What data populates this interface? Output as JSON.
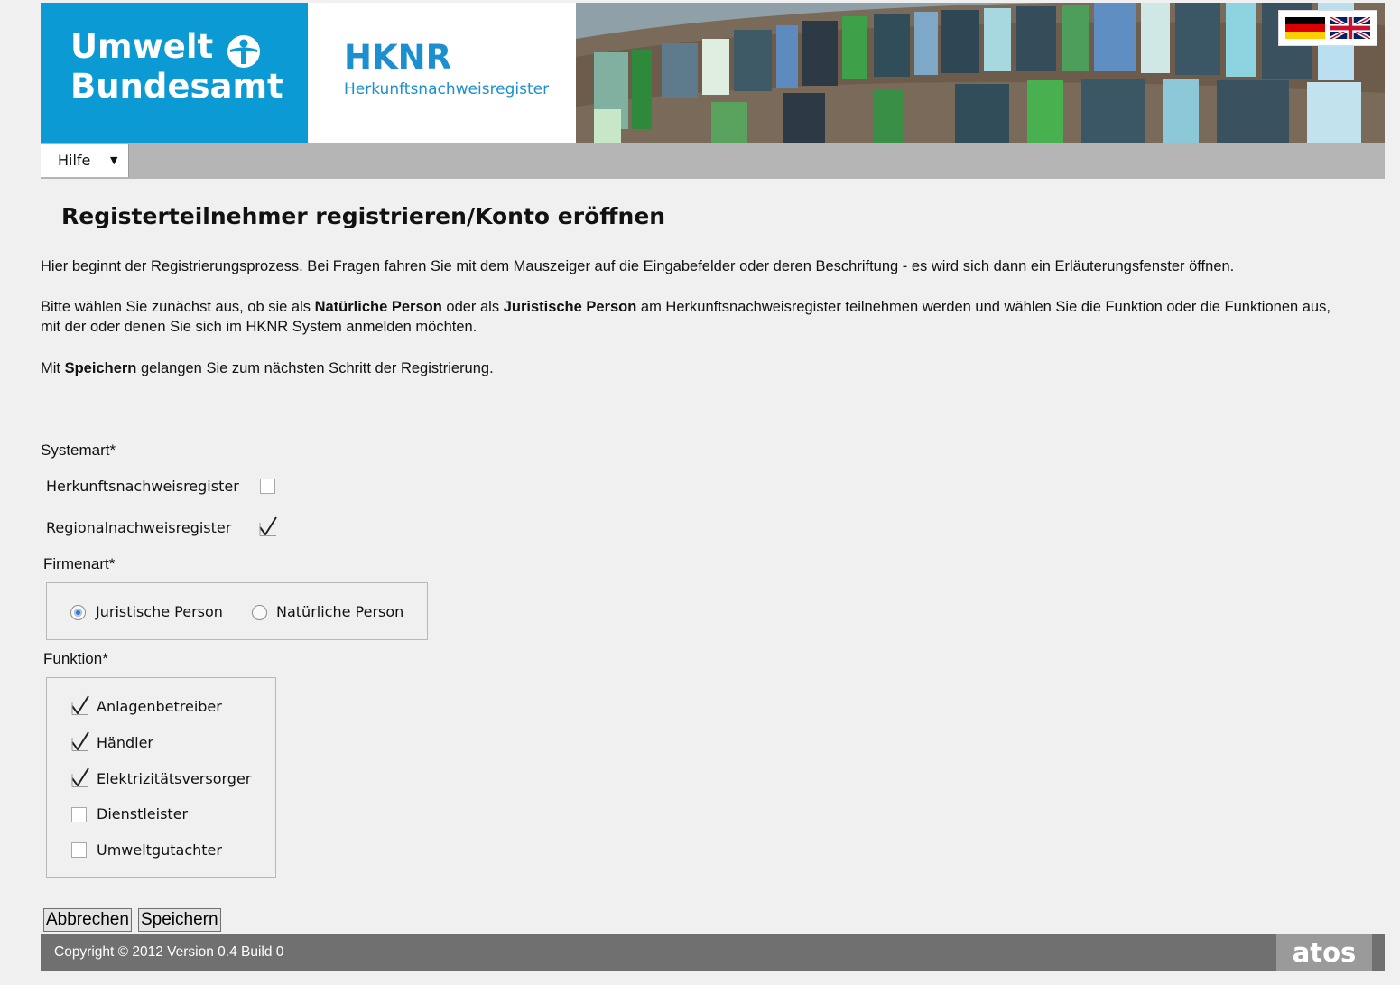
{
  "header": {
    "logo_line1": "Umwelt",
    "logo_line2": "Bundesamt",
    "app_title": "HKNR",
    "app_subtitle": "Herkunftsnachweisregister",
    "languages": [
      "german-flag",
      "uk-flag"
    ]
  },
  "menu": {
    "help_label": "Hilfe",
    "help_caret": "▼"
  },
  "page": {
    "title": "Registerteilnehmer registrieren/Konto eröffnen",
    "intro": "Hier beginnt der Registrierungsprozess. Bei Fragen fahren Sie mit dem Mauszeiger auf die Eingabefelder oder deren Beschriftung - es wird sich dann ein Erläuterungsfenster öffnen.",
    "p2_a": "Bitte wählen Sie zunächst aus, ob sie als ",
    "p2_b": "Natürliche Person",
    "p2_c": " oder als ",
    "p2_d": "Juristische Person",
    "p2_e": " am Herkunftsnachweisregister teilnehmen werden und wählen Sie die Funktion oder die Funktionen aus, mit der oder denen Sie sich im HKNR System anmelden möchten.",
    "p3_a": "Mit ",
    "p3_b": "Speichern",
    "p3_c": " gelangen Sie zum nächsten Schritt der Registrierung."
  },
  "form": {
    "systemart_label": "Systemart*",
    "systemart_options": [
      {
        "label": "Herkunftsnachweisregister",
        "checked": false
      },
      {
        "label": "Regionalnachweisregister",
        "checked": true
      }
    ],
    "firmenart_label": "Firmenart*",
    "firmenart_options": [
      {
        "label": "Juristische Person",
        "selected": true
      },
      {
        "label": "Natürliche Person",
        "selected": false
      }
    ],
    "funktion_label": "Funktion*",
    "funktion_options": [
      {
        "label": "Anlagenbetreiber",
        "checked": true
      },
      {
        "label": "Händler",
        "checked": true
      },
      {
        "label": "Elektrizitätsversorger",
        "checked": true
      },
      {
        "label": "Dienstleister",
        "checked": false
      },
      {
        "label": "Umweltgutachter",
        "checked": false
      }
    ],
    "cancel_label": "Abbrechen",
    "save_label": "Speichern"
  },
  "footer": {
    "copyright": "Copyright © 2012   Version 0.4 Build 0",
    "brand": "atos"
  },
  "colors": {
    "brand_blue": "#0b9ad3",
    "title_blue": "#1c8fd0",
    "menubar_grey": "#b5b5b5",
    "footer_grey": "#707070"
  }
}
